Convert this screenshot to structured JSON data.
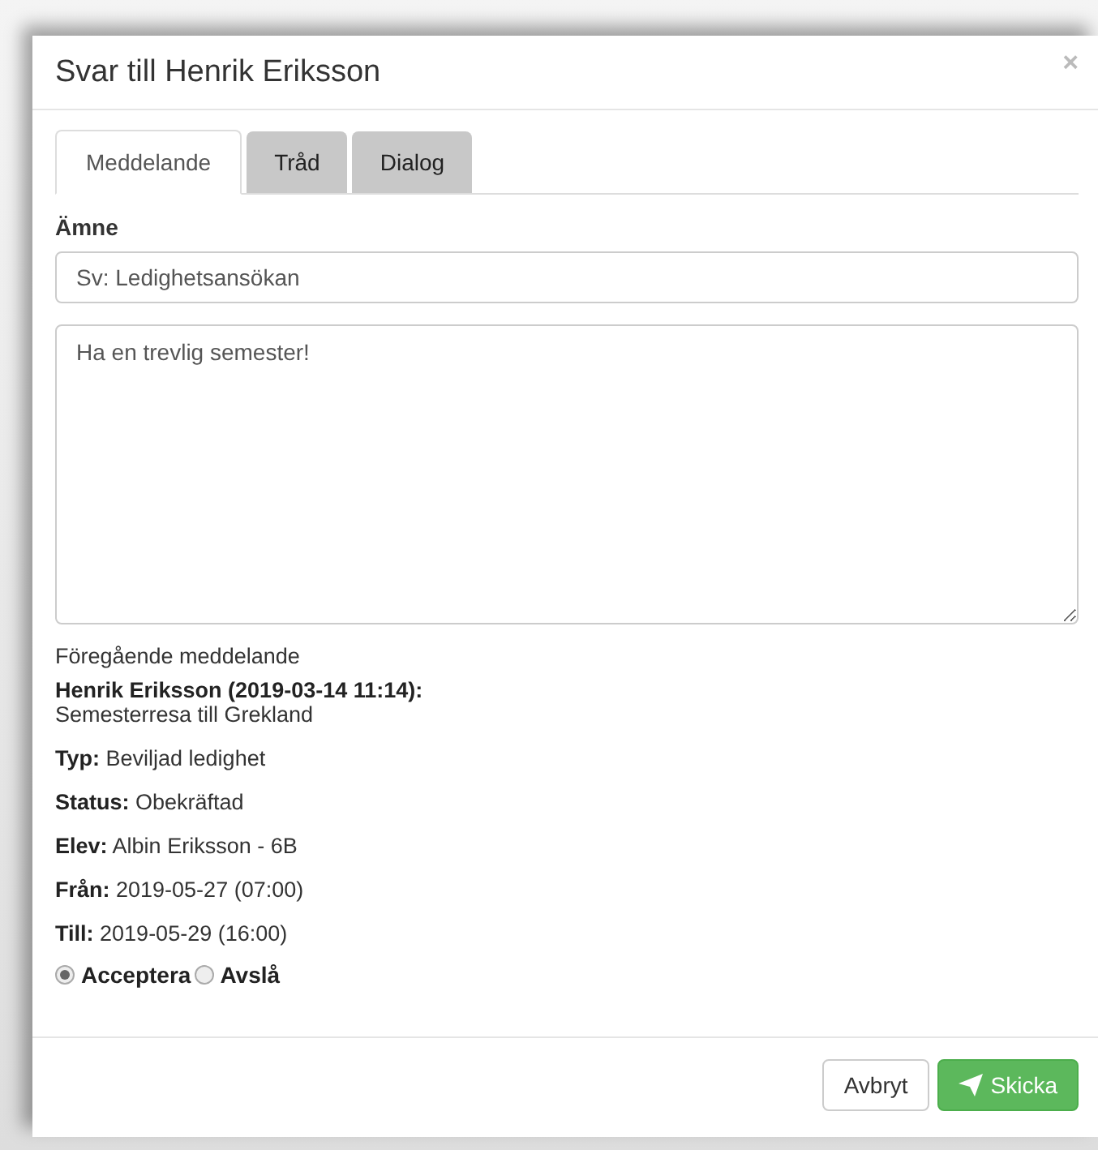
{
  "dialog": {
    "title": "Svar till Henrik Eriksson",
    "close": "×"
  },
  "tabs": [
    {
      "label": "Meddelande",
      "selected": true
    },
    {
      "label": "Tråd",
      "selected": false
    },
    {
      "label": "Dialog",
      "selected": false
    }
  ],
  "subject": {
    "label": "Ämne",
    "value": "Sv: Ledighetsansökan"
  },
  "message": {
    "value": "Ha en trevlig semester!"
  },
  "previous": {
    "heading": "Föregående meddelande",
    "author": "Henrik Eriksson (2019-03-14 11:14):",
    "text": "Semesterresa till Grekland"
  },
  "details": [
    {
      "label": "Typ:",
      "value": "Beviljad ledighet"
    },
    {
      "label": "Status:",
      "value": "Obekräftad"
    },
    {
      "label": "Elev:",
      "value": "Albin Eriksson - 6B"
    },
    {
      "label": "Från:",
      "value": "2019-05-27 (07:00)"
    },
    {
      "label": "Till:",
      "value": "2019-05-29 (16:00)"
    }
  ],
  "decision": [
    {
      "label": "Acceptera",
      "selected": true
    },
    {
      "label": "Avslå",
      "selected": false
    }
  ],
  "buttons": [
    {
      "label": "Avbryt",
      "kind": "default"
    },
    {
      "label": "Skicka",
      "kind": "primary"
    }
  ]
}
